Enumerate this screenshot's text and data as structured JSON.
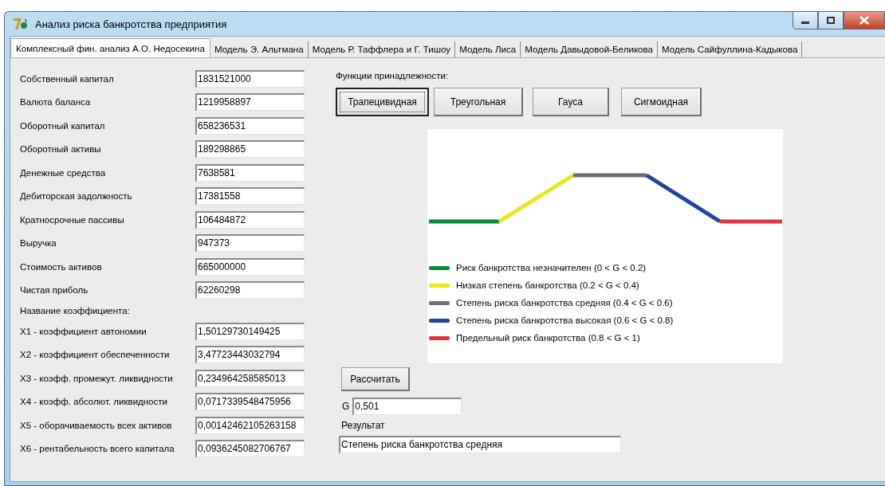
{
  "window": {
    "title": "Анализ риска банкротства предприятия"
  },
  "tabs": [
    {
      "label": "Комплексный фин. анализ А.О. Недосекина",
      "selected": true
    },
    {
      "label": "Модель Э. Альтмана",
      "selected": false
    },
    {
      "label": "Модель Р. Таффлера и Г. Тишоу",
      "selected": false
    },
    {
      "label": "Модель Лиса",
      "selected": false
    },
    {
      "label": "Модель Давыдовой-Беликова",
      "selected": false
    },
    {
      "label": "Модель Сайфуллина-Кадыкова",
      "selected": false
    }
  ],
  "inputs": [
    {
      "label": "Собственный капитал",
      "value": "1831521000"
    },
    {
      "label": "Валюта баланса",
      "value": "1219958897"
    },
    {
      "label": "Оборотный капитал",
      "value": "658236531"
    },
    {
      "label": "Оборотный активы",
      "value": "189298865"
    },
    {
      "label": "Денежные средства",
      "value": "7638581"
    },
    {
      "label": "Дебиторская задолжность",
      "value": "17381558"
    },
    {
      "label": "Кратносрочные пассивы",
      "value": "106484872"
    },
    {
      "label": "Выручка",
      "value": "947373"
    },
    {
      "label": "Стоимость активов",
      "value": "665000000"
    },
    {
      "label": "Чистая приболь",
      "value": "62260298"
    }
  ],
  "coefficients_heading": "Название коэффициента:",
  "coefficients": [
    {
      "label": "X1 - коэффициент автономии",
      "value": "1,50129730149425"
    },
    {
      "label": "X2 - коэффициент обеспеченности",
      "value": "3,47723443032794"
    },
    {
      "label": "X3 - коэфф. промежут. ликвидности",
      "value": "0,234964258585013"
    },
    {
      "label": "X4 - коэфф. абсолют. ликвидности",
      "value": "0,0717339548475956"
    },
    {
      "label": "X5 -  оборачиваемость всех активов",
      "value": "0,00142462105263158"
    },
    {
      "label": "X6 - рентабельность всего капитала",
      "value": "0,0936245082706767"
    }
  ],
  "membership": {
    "heading": "Функции принадлежности:",
    "buttons": [
      {
        "label": "Трапецивидная",
        "focused": true
      },
      {
        "label": "Треугольная",
        "focused": false
      },
      {
        "label": "Гауса",
        "focused": false
      },
      {
        "label": "Сигмоидная",
        "focused": false
      }
    ]
  },
  "legend": [
    {
      "label": "Риск банкротства незначителен (0 < G < 0.2)",
      "color": "#108a3a"
    },
    {
      "label": "Низкая степень банкротства (0.2 < G < 0.4)",
      "color": "#e8e81a"
    },
    {
      "label": "Степень риска банкротства средняя (0.4 < G < 0.6)",
      "color": "#6e7073"
    },
    {
      "label": "Степень риска банкротства высокая (0.6 < G < 0.8)",
      "color": "#1e44a0"
    },
    {
      "label": "Предельный риск банкротства (0.8 < G < 1)",
      "color": "#e8333a"
    }
  ],
  "calculate_button": "Рассчитать",
  "g": {
    "label": "G",
    "value": "0,501"
  },
  "result": {
    "label": "Результат",
    "value": "Степень риска банкротства средняя"
  }
}
